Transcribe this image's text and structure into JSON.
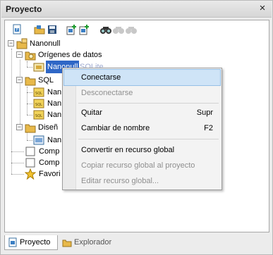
{
  "window": {
    "title": "Proyecto",
    "close_glyph": "×"
  },
  "toolbar": {
    "buttons": [
      {
        "name": "new-project-icon"
      },
      {
        "name": "open-project-icon"
      },
      {
        "name": "save-project-icon"
      },
      {
        "name": "add-datasource-icon"
      },
      {
        "name": "add-sql-icon"
      },
      {
        "name": "find-icon"
      },
      {
        "name": "find-next-icon"
      },
      {
        "name": "find-previous-icon"
      }
    ]
  },
  "tree": {
    "root": "Nanonull",
    "datasources_folder": "Orígenes de datos",
    "datasource_name": "Nanonull",
    "datasource_kind": "SQLite",
    "sql_folder": "SQL",
    "sql_items": [
      "Nan",
      "Nan",
      "Nan"
    ],
    "design_folder": "Diseñ",
    "design_items": [
      "Nan"
    ],
    "other_items": [
      "Comp",
      "Comp"
    ],
    "favorites": "Favori"
  },
  "context_menu": {
    "items": [
      {
        "label": "Conectarse",
        "shortcut": "",
        "state": "hover"
      },
      {
        "label": "Desconectarse",
        "shortcut": "",
        "state": "disabled"
      },
      {
        "label": "Quitar",
        "shortcut": "Supr",
        "state": "normal"
      },
      {
        "label": "Cambiar de nombre",
        "shortcut": "F2",
        "state": "normal"
      },
      {
        "label": "Convertir en recurso global",
        "shortcut": "",
        "state": "normal"
      },
      {
        "label": "Copiar recurso global al proyecto",
        "shortcut": "",
        "state": "disabled"
      },
      {
        "label": "Editar recurso global...",
        "shortcut": "",
        "state": "disabled"
      }
    ]
  },
  "tabs": [
    {
      "label": "Proyecto",
      "active": true
    },
    {
      "label": "Explorador",
      "active": false
    }
  ],
  "colors": {
    "selection": "#2f67c6",
    "menu_hover": "#cfe4f7",
    "folder": "#e8b94a"
  }
}
